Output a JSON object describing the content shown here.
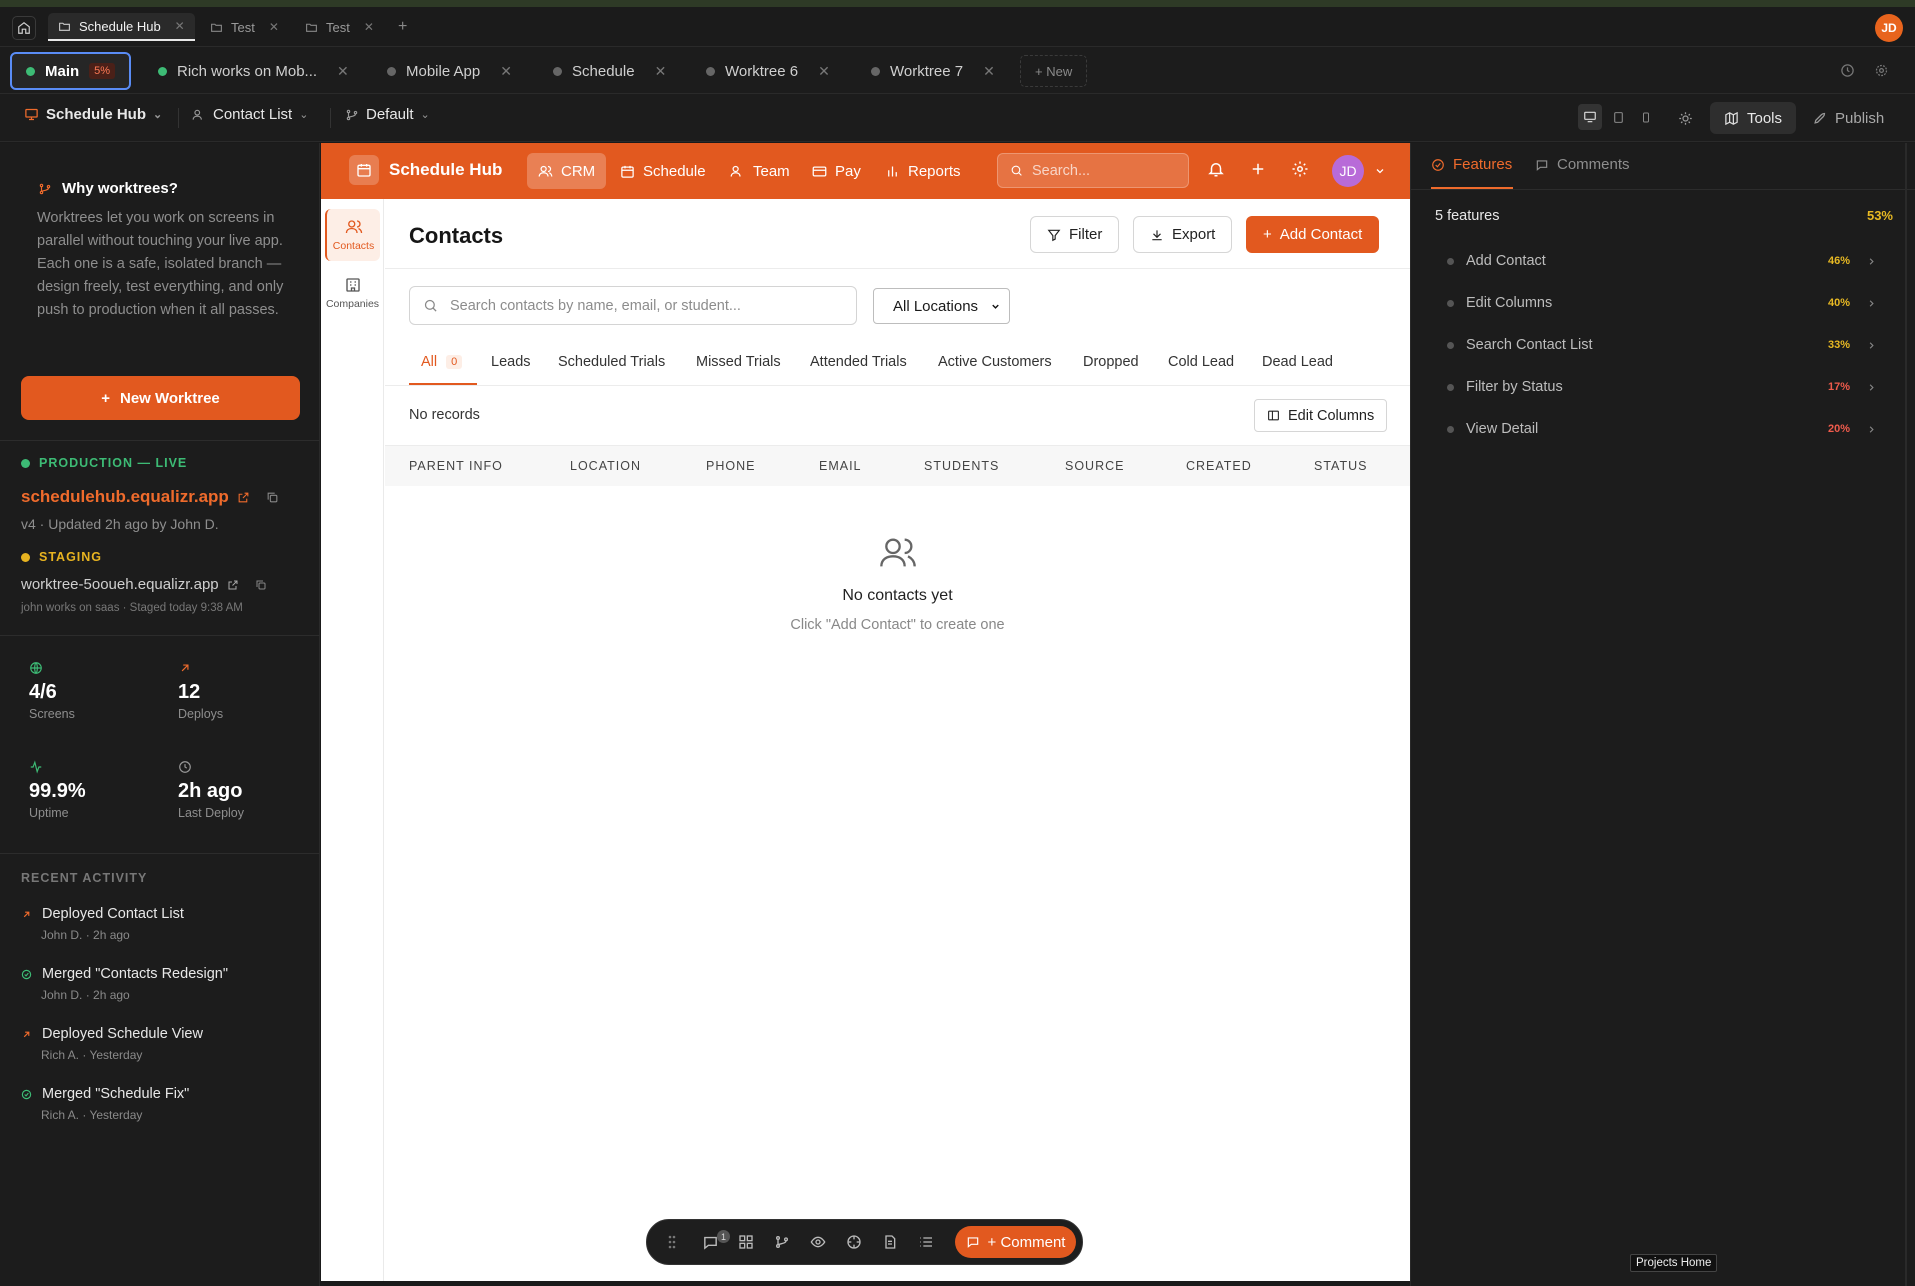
{
  "window_tabs": [
    {
      "label": "Schedule Hub",
      "active": true
    },
    {
      "label": "Test",
      "active": false
    },
    {
      "label": "Test",
      "active": false
    }
  ],
  "user_initials": "JD",
  "worktrees": [
    {
      "label": "Main",
      "badge": "5%",
      "status_color": "#3dbb75",
      "active": true
    },
    {
      "label": "Rich works on Mob...",
      "status_color": "#3dbb75"
    },
    {
      "label": "Mobile App",
      "status_color": "#666666"
    },
    {
      "label": "Schedule",
      "status_color": "#666666"
    },
    {
      "label": "Worktree 6",
      "status_color": "#666666"
    },
    {
      "label": "Worktree 7",
      "status_color": "#666666"
    }
  ],
  "new_worktree_tab": "+ New",
  "toolbar": {
    "project": "Schedule Hub",
    "screen": "Contact List",
    "branch": "Default",
    "tools": "Tools",
    "publish": "Publish"
  },
  "sidebar": {
    "why_title": "Why worktrees?",
    "why_text": "Worktrees let you work on screens in parallel without touching your live app. Each one is a safe, isolated branch — design freely, test everything, and only push to production when it all passes.",
    "new_worktree_button": "New Worktree",
    "production": {
      "label": "PRODUCTION — LIVE",
      "url": "schedulehub.equalizr.app",
      "meta": "v4 · Updated 2h ago by John D."
    },
    "staging": {
      "label": "STAGING",
      "url": "worktree-5ooueh.equalizr.app",
      "meta": "john works on saas · Staged today 9:38 AM"
    },
    "stats": [
      {
        "value": "4/6",
        "label": "Screens",
        "icon": "globe-icon"
      },
      {
        "value": "12",
        "label": "Deploys",
        "icon": "arrow-up-right-icon"
      },
      {
        "value": "99.9%",
        "label": "Uptime",
        "icon": "activity-icon"
      },
      {
        "value": "2h ago",
        "label": "Last Deploy",
        "icon": "clock-icon"
      }
    ],
    "recent_title": "RECENT ACTIVITY",
    "activity": [
      {
        "title": "Deployed Contact List",
        "meta": "John D. · 2h ago",
        "kind": "deploy"
      },
      {
        "title": "Merged \"Contacts Redesign\"",
        "meta": "John D. · 2h ago",
        "kind": "merge"
      },
      {
        "title": "Deployed Schedule View",
        "meta": "Rich A. · Yesterday",
        "kind": "deploy"
      },
      {
        "title": "Merged \"Schedule Fix\"",
        "meta": "Rich A. · Yesterday",
        "kind": "merge"
      }
    ]
  },
  "app": {
    "brand": "Schedule Hub",
    "nav": [
      "CRM",
      "Schedule",
      "Team",
      "Pay",
      "Reports"
    ],
    "search_placeholder": "Search...",
    "avatar": "JD",
    "side_nav": [
      "Contacts",
      "Companies"
    ],
    "page_title": "Contacts",
    "filter_label": "Filter",
    "export_label": "Export",
    "add_contact_label": "Add Contact",
    "contact_search_placeholder": "Search contacts by name, email, or student...",
    "location_select": "All Locations",
    "tabs": [
      {
        "label": "All",
        "count": "0"
      },
      {
        "label": "Leads"
      },
      {
        "label": "Scheduled Trials"
      },
      {
        "label": "Missed Trials"
      },
      {
        "label": "Attended Trials"
      },
      {
        "label": "Active Customers"
      },
      {
        "label": "Dropped"
      },
      {
        "label": "Cold Lead"
      },
      {
        "label": "Dead Lead"
      }
    ],
    "no_records": "No records",
    "edit_columns": "Edit Columns",
    "columns": [
      "PARENT INFO",
      "LOCATION",
      "PHONE",
      "EMAIL",
      "STUDENTS",
      "SOURCE",
      "CREATED",
      "STATUS"
    ],
    "empty_title": "No contacts yet",
    "empty_sub": "Click \"Add Contact\" to create one"
  },
  "dock": {
    "comment_badge": "1",
    "comment_button": "+ Comment"
  },
  "right_panel": {
    "tabs": [
      "Features",
      "Comments"
    ],
    "features_count": "5 features",
    "features_total": "53%",
    "features": [
      {
        "name": "Add Contact",
        "pct": "46%",
        "color": "#e8b923"
      },
      {
        "name": "Edit Columns",
        "pct": "40%",
        "color": "#e8b923"
      },
      {
        "name": "Search Contact List",
        "pct": "33%",
        "color": "#e8b923"
      },
      {
        "name": "Filter by Status",
        "pct": "17%",
        "color": "#ef5b4c"
      },
      {
        "name": "View Detail",
        "pct": "20%",
        "color": "#ef5b4c"
      }
    ]
  },
  "tooltip": "Projects Home"
}
